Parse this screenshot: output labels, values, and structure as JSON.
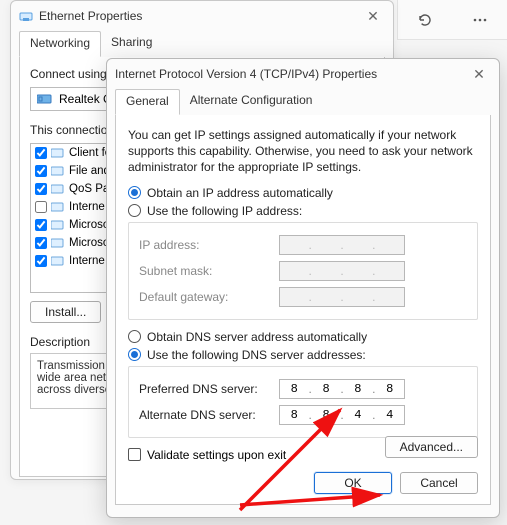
{
  "topright": {
    "refresh": "refresh",
    "menu": "menu"
  },
  "back": {
    "title": "Ethernet Properties",
    "tabs": {
      "networking": "Networking",
      "sharing": "Sharing"
    },
    "connect_using_label": "Connect using:",
    "adapter": "Realtek G",
    "uses_label": "This connection",
    "items": [
      {
        "checked": true,
        "label": "Client fo"
      },
      {
        "checked": true,
        "label": "File and"
      },
      {
        "checked": true,
        "label": "QoS Pa"
      },
      {
        "checked": false,
        "label": "Interne"
      },
      {
        "checked": true,
        "label": "Microso"
      },
      {
        "checked": true,
        "label": "Microso"
      },
      {
        "checked": true,
        "label": "Interne"
      }
    ],
    "install_btn": "Install...",
    "desc_title": "Description",
    "desc_text": "Transmission \nwide area net\nacross diverse"
  },
  "front": {
    "title": "Internet Protocol Version 4 (TCP/IPv4) Properties",
    "tabs": {
      "general": "General",
      "alt": "Alternate Configuration"
    },
    "intro": "You can get IP settings assigned automatically if your network supports this capability. Otherwise, you need to ask your network administrator for the appropriate IP settings.",
    "ip_auto": "Obtain an IP address automatically",
    "ip_manual": "Use the following IP address:",
    "ip_fields": {
      "ip": "IP address:",
      "subnet": "Subnet mask:",
      "gateway": "Default gateway:"
    },
    "dns_auto": "Obtain DNS server address automatically",
    "dns_manual": "Use the following DNS server addresses:",
    "dns_fields": {
      "pref": "Preferred DNS server:",
      "alt": "Alternate DNS server:"
    },
    "dns_values": {
      "pref": [
        "8",
        "8",
        "8",
        "8"
      ],
      "alt": [
        "8",
        "8",
        "4",
        "4"
      ]
    },
    "validate": "Validate settings upon exit",
    "advanced": "Advanced...",
    "ok": "OK",
    "cancel": "Cancel"
  }
}
